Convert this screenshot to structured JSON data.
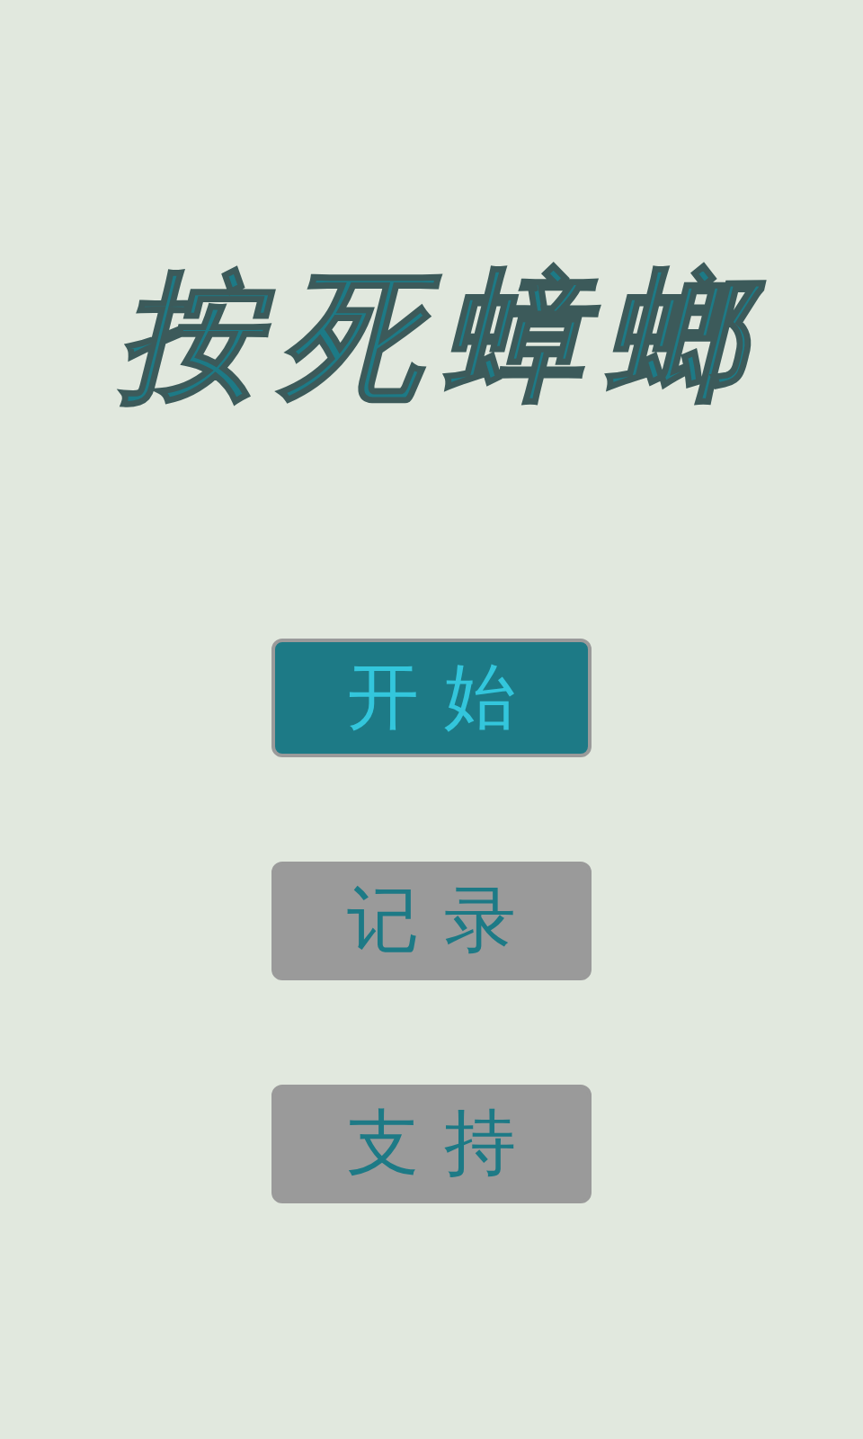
{
  "title": "按死蟑螂",
  "menu": [
    {
      "label": "开始",
      "selected": true
    },
    {
      "label": "记录",
      "selected": false
    },
    {
      "label": "支持",
      "selected": false
    }
  ]
}
